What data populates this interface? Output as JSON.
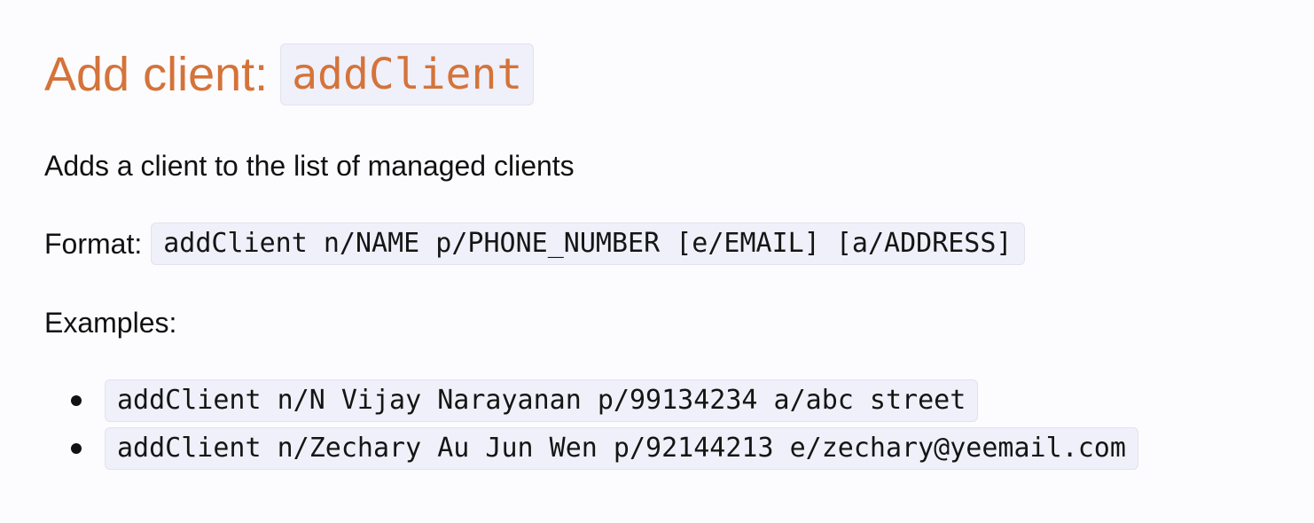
{
  "section": {
    "title_prefix": "Add client:",
    "command_name": "addClient",
    "description": "Adds a client to the list of managed clients",
    "format_label": "Format:",
    "format_code": "addClient n/NAME p/PHONE_NUMBER [e/EMAIL] [a/ADDRESS]",
    "examples_label": "Examples:",
    "examples": [
      "addClient n/N Vijay Narayanan p/99134234 a/abc street",
      "addClient n/Zechary Au Jun Wen p/92144213 e/zechary@yeemail.com"
    ]
  },
  "colors": {
    "heading": "#d4733a",
    "code_background": "#f0f0fa",
    "page_background": "#fcfcfe"
  }
}
